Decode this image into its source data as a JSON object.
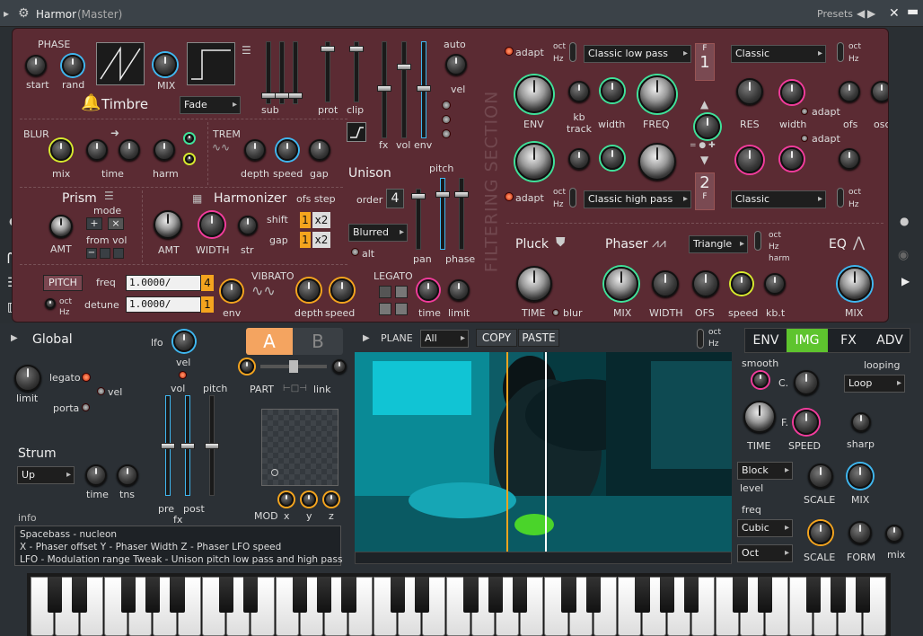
{
  "titlebar": {
    "title": "Harmor",
    "subtitle": "(Master)",
    "presets": "Presets"
  },
  "top": {
    "phase": "PHASE",
    "start": "start",
    "rand": "rand",
    "mix": "MIX",
    "timbre": "Timbre",
    "fade": "Fade",
    "sub": "sub",
    "prot": "prot",
    "clip": "clip",
    "fx": "fx",
    "vol": "vol",
    "env": "env",
    "auto": "auto",
    "vel": "vel",
    "blur": "BLUR",
    "blur_mix": "mix",
    "blur_time": "time",
    "harm": "harm",
    "trem": "TREM",
    "depth": "depth",
    "speed": "speed",
    "gap": "gap",
    "unison": "Unison",
    "pitch": "pitch",
    "order": "order",
    "order_val": "4",
    "blurred": "Blurred",
    "alt": "alt",
    "pan": "pan",
    "phase_lbl": "phase",
    "prism": "Prism",
    "mode": "mode",
    "amt": "AMT",
    "from_vol": "from vol",
    "harmonizer": "Harmonizer",
    "ofs_step": "ofs step",
    "h_amt": "AMT",
    "width": "WIDTH",
    "str": "str",
    "shift": "shift",
    "gap2": "gap",
    "x2a": "x2",
    "x2b": "x2",
    "one_a": "1",
    "one_b": "1",
    "pitch_btn": "PITCH",
    "freq": "freq",
    "detune": "detune",
    "oct": "oct",
    "hz": "Hz",
    "freq_val": "1.0000/",
    "freq_end": "4",
    "detune_val": "1.0000/",
    "detune_end": "1",
    "env2": "env",
    "vibrato": "VIBRATO",
    "v_depth": "depth",
    "v_speed": "speed",
    "legato": "LEGATO",
    "l_time": "time",
    "l_limit": "limit",
    "filtering": "FILTERING SECTION",
    "adapt": "adapt",
    "f_oct": "oct",
    "f_hz": "Hz",
    "filter1": "Classic low pass",
    "filter2": "Classic high pass",
    "env_lbl": "ENV",
    "kb_track": "kb track",
    "f_width": "width",
    "freq_lbl": "FREQ",
    "f1": "F",
    "f1n": "1",
    "f2": "F",
    "f2n": "2",
    "classic1": "Classic",
    "classic2": "Classic",
    "res": "RES",
    "width2": "width",
    "adapt2": "adapt",
    "adapt3": "adapt",
    "ofs": "ofs",
    "osc": "osc",
    "pluck": "Pluck",
    "time": "TIME",
    "blur2": "blur",
    "phaser": "Phaser",
    "triangle": "Triangle",
    "harm2": "harm",
    "p_mix": "MIX",
    "p_width": "WIDTH",
    "p_ofs": "OFS",
    "p_speed": "speed",
    "kbt": "kb.t",
    "eq": "EQ",
    "eq_mix": "MIX"
  },
  "global": {
    "title": "Global",
    "lfo": "lfo",
    "limit": "limit",
    "legato": "legato",
    "vel": "vel",
    "porta": "porta",
    "strum": "Strum",
    "up": "Up",
    "time": "time",
    "tns": "tns",
    "info": "info",
    "A": "A",
    "B": "B",
    "part": "PART",
    "link": "link",
    "vol": "vol",
    "pitch": "pitch",
    "pre": "pre",
    "post": "post",
    "fx": "fx",
    "vel2": "vel",
    "mod": "MOD",
    "x": "x",
    "y": "y",
    "z": "z",
    "info_lines": [
      "Spacebass - nucleon",
      "X - Phaser offset  Y - Phaser Width  Z - Phaser LFO speed",
      "LFO - Modulation range  Tweak - Unison pitch low pass and high pass"
    ]
  },
  "plane": {
    "label": "PLANE",
    "value": "All",
    "copy": "COPY",
    "paste": "PASTE",
    "oct": "oct",
    "hz": "Hz"
  },
  "right": {
    "tabs": [
      "ENV",
      "IMG",
      "FX",
      "ADV"
    ],
    "active": "IMG",
    "smooth": "smooth",
    "looping": "looping",
    "loop": "Loop",
    "c": "C.",
    "f": "F.",
    "time": "TIME",
    "speed": "SPEED",
    "sharp": "sharp",
    "block": "Block",
    "level": "level",
    "freq": "freq",
    "cubic": "Cubic",
    "oct": "Oct",
    "scale1": "SCALE",
    "mix": "MIX",
    "scale2": "SCALE",
    "form": "FORM",
    "mix2": "mix"
  },
  "colors": {
    "panel": "#5a2a32",
    "dark": "#24282c",
    "accent_green": "#3fe29a",
    "accent_pink": "#f23c9c",
    "accent_orange": "#f4a41e",
    "accent_cyan": "#3fb7f0",
    "img_tab": "#5ec42e"
  }
}
